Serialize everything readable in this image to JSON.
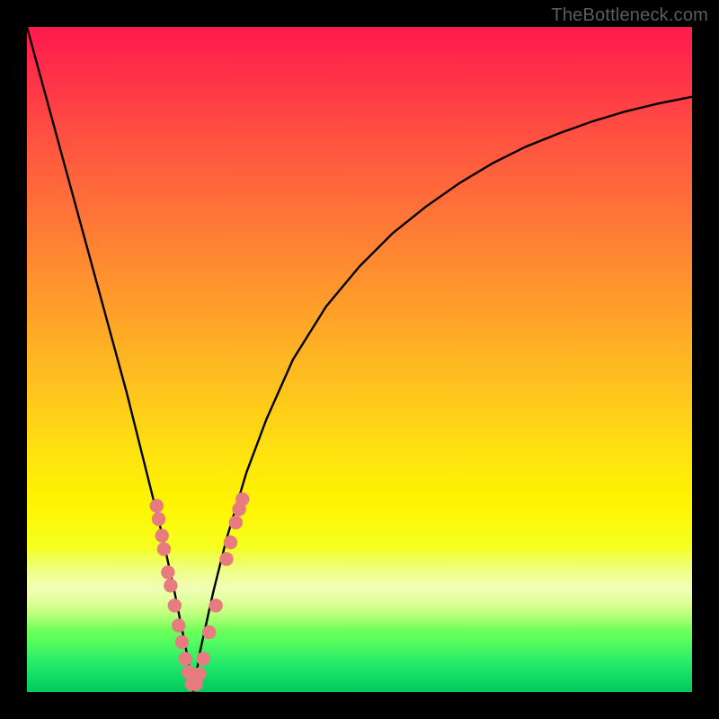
{
  "watermark": "TheBottleneck.com",
  "colors": {
    "frame": "#000000",
    "curve": "#000000",
    "dot": "#e77b80"
  },
  "chart_data": {
    "type": "line",
    "title": "",
    "xlabel": "",
    "ylabel": "",
    "xlim": [
      0,
      100
    ],
    "ylim": [
      0,
      100
    ],
    "grid": false,
    "legend": false,
    "note": "V-shaped bottleneck curve; y is mismatch (100=red top, 0=green bottom). Minimum near x≈25; right branch rises with diminishing slope.",
    "series": [
      {
        "name": "bottleneck-curve",
        "x": [
          0,
          3,
          6,
          9,
          12,
          15,
          18,
          20,
          22,
          24,
          25,
          26,
          28,
          30,
          33,
          36,
          40,
          45,
          50,
          55,
          60,
          65,
          70,
          75,
          80,
          85,
          90,
          95,
          100
        ],
        "y": [
          100,
          89,
          78,
          67,
          56,
          45,
          33,
          25,
          16,
          6,
          0,
          6,
          15,
          23,
          33,
          41,
          50,
          58,
          64,
          69,
          73,
          76.5,
          79.5,
          82,
          84,
          85.8,
          87.3,
          88.5,
          89.5
        ]
      }
    ],
    "scatter": {
      "name": "highlight-dots",
      "points": [
        {
          "x": 19.5,
          "y": 28
        },
        {
          "x": 19.8,
          "y": 26
        },
        {
          "x": 20.3,
          "y": 23.5
        },
        {
          "x": 20.6,
          "y": 21.5
        },
        {
          "x": 21.2,
          "y": 18
        },
        {
          "x": 21.6,
          "y": 16
        },
        {
          "x": 22.2,
          "y": 13
        },
        {
          "x": 22.8,
          "y": 10
        },
        {
          "x": 23.3,
          "y": 7.5
        },
        {
          "x": 23.8,
          "y": 5
        },
        {
          "x": 24.3,
          "y": 3
        },
        {
          "x": 24.8,
          "y": 1.2
        },
        {
          "x": 25.4,
          "y": 1.2
        },
        {
          "x": 25.9,
          "y": 2.7
        },
        {
          "x": 26.5,
          "y": 5
        },
        {
          "x": 27.4,
          "y": 9
        },
        {
          "x": 28.4,
          "y": 13
        },
        {
          "x": 30.0,
          "y": 20
        },
        {
          "x": 30.6,
          "y": 22.5
        },
        {
          "x": 31.4,
          "y": 25.5
        },
        {
          "x": 31.9,
          "y": 27.5
        },
        {
          "x": 32.4,
          "y": 29
        }
      ]
    }
  }
}
